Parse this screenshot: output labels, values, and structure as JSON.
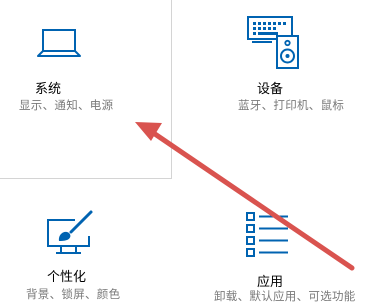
{
  "accent_color": "#0063b1",
  "annotation_arrow_color": "#d9534f",
  "tiles": {
    "system": {
      "title": "系统",
      "desc": "显示、通知、电源",
      "icon": "laptop-icon"
    },
    "devices": {
      "title": "设备",
      "desc": "蓝牙、打印机、鼠标",
      "icon": "keyboard-speaker-icon"
    },
    "personalization": {
      "title": "个性化",
      "desc": "背景、锁屏、颜色",
      "icon": "paint-monitor-icon"
    },
    "apps": {
      "title": "应用",
      "desc": "卸载、默认应用、可选功能",
      "icon": "app-list-icon"
    }
  }
}
